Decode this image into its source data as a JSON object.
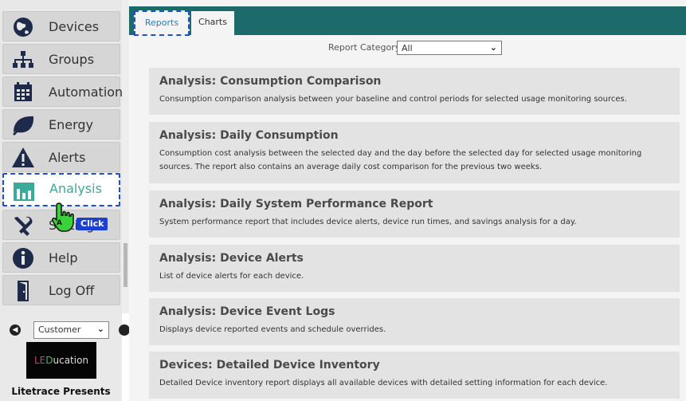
{
  "sidebar": {
    "items": [
      {
        "label": "Devices",
        "icon": "globe-icon"
      },
      {
        "label": "Groups",
        "icon": "org-chart-icon"
      },
      {
        "label": "Automation",
        "icon": "calendar-icon"
      },
      {
        "label": "Energy",
        "icon": "leaf-icon"
      },
      {
        "label": "Alerts",
        "icon": "warning-icon"
      },
      {
        "label": "Analysis",
        "icon": "bar-chart-icon",
        "active": true
      },
      {
        "label": "Settings",
        "icon": "tools-icon"
      },
      {
        "label": "Help",
        "icon": "info-icon"
      },
      {
        "label": "Log Off",
        "icon": "door-icon"
      }
    ],
    "customer_select": {
      "value": "Customer"
    },
    "promo": {
      "logo_le": "LE",
      "logo_d": "D",
      "logo_rest": "ucation",
      "caption": "Litetrace Presents"
    }
  },
  "click_annotation": {
    "badge": "Click",
    "key": "A"
  },
  "tabs": [
    {
      "label": "Reports",
      "active": true
    },
    {
      "label": "Charts",
      "active": false
    }
  ],
  "report_category": {
    "label": "Report Category:",
    "value": "All"
  },
  "reports": [
    {
      "title": "Analysis: Consumption Comparison",
      "description": "Consumption comparison analysis between your baseline and control periods for selected usage monitoring sources."
    },
    {
      "title": "Analysis: Daily Consumption",
      "description": "Consumption cost analysis between the selected day and the day before the selected day for selected usage monitoring sources. The report also contains an average daily cost comparison for the previous two weeks."
    },
    {
      "title": "Analysis: Daily System Performance Report",
      "description": "System performance report that includes device alerts, device run times, and savings analysis for a day."
    },
    {
      "title": "Analysis: Device Alerts",
      "description": "List of device alerts for each device."
    },
    {
      "title": "Analysis: Device Event Logs",
      "description": "Displays device reported events and schedule overrides."
    },
    {
      "title": "Devices: Detailed Device Inventory",
      "description": "Detailed Device inventory report displays all available devices with detailed setting information for each device."
    }
  ],
  "colors": {
    "tab_bar": "#1c6b6a",
    "active_accent": "#3aaa9a",
    "icon_navy": "#1e2a4a",
    "highlight_dash": "#1f4fd1"
  }
}
